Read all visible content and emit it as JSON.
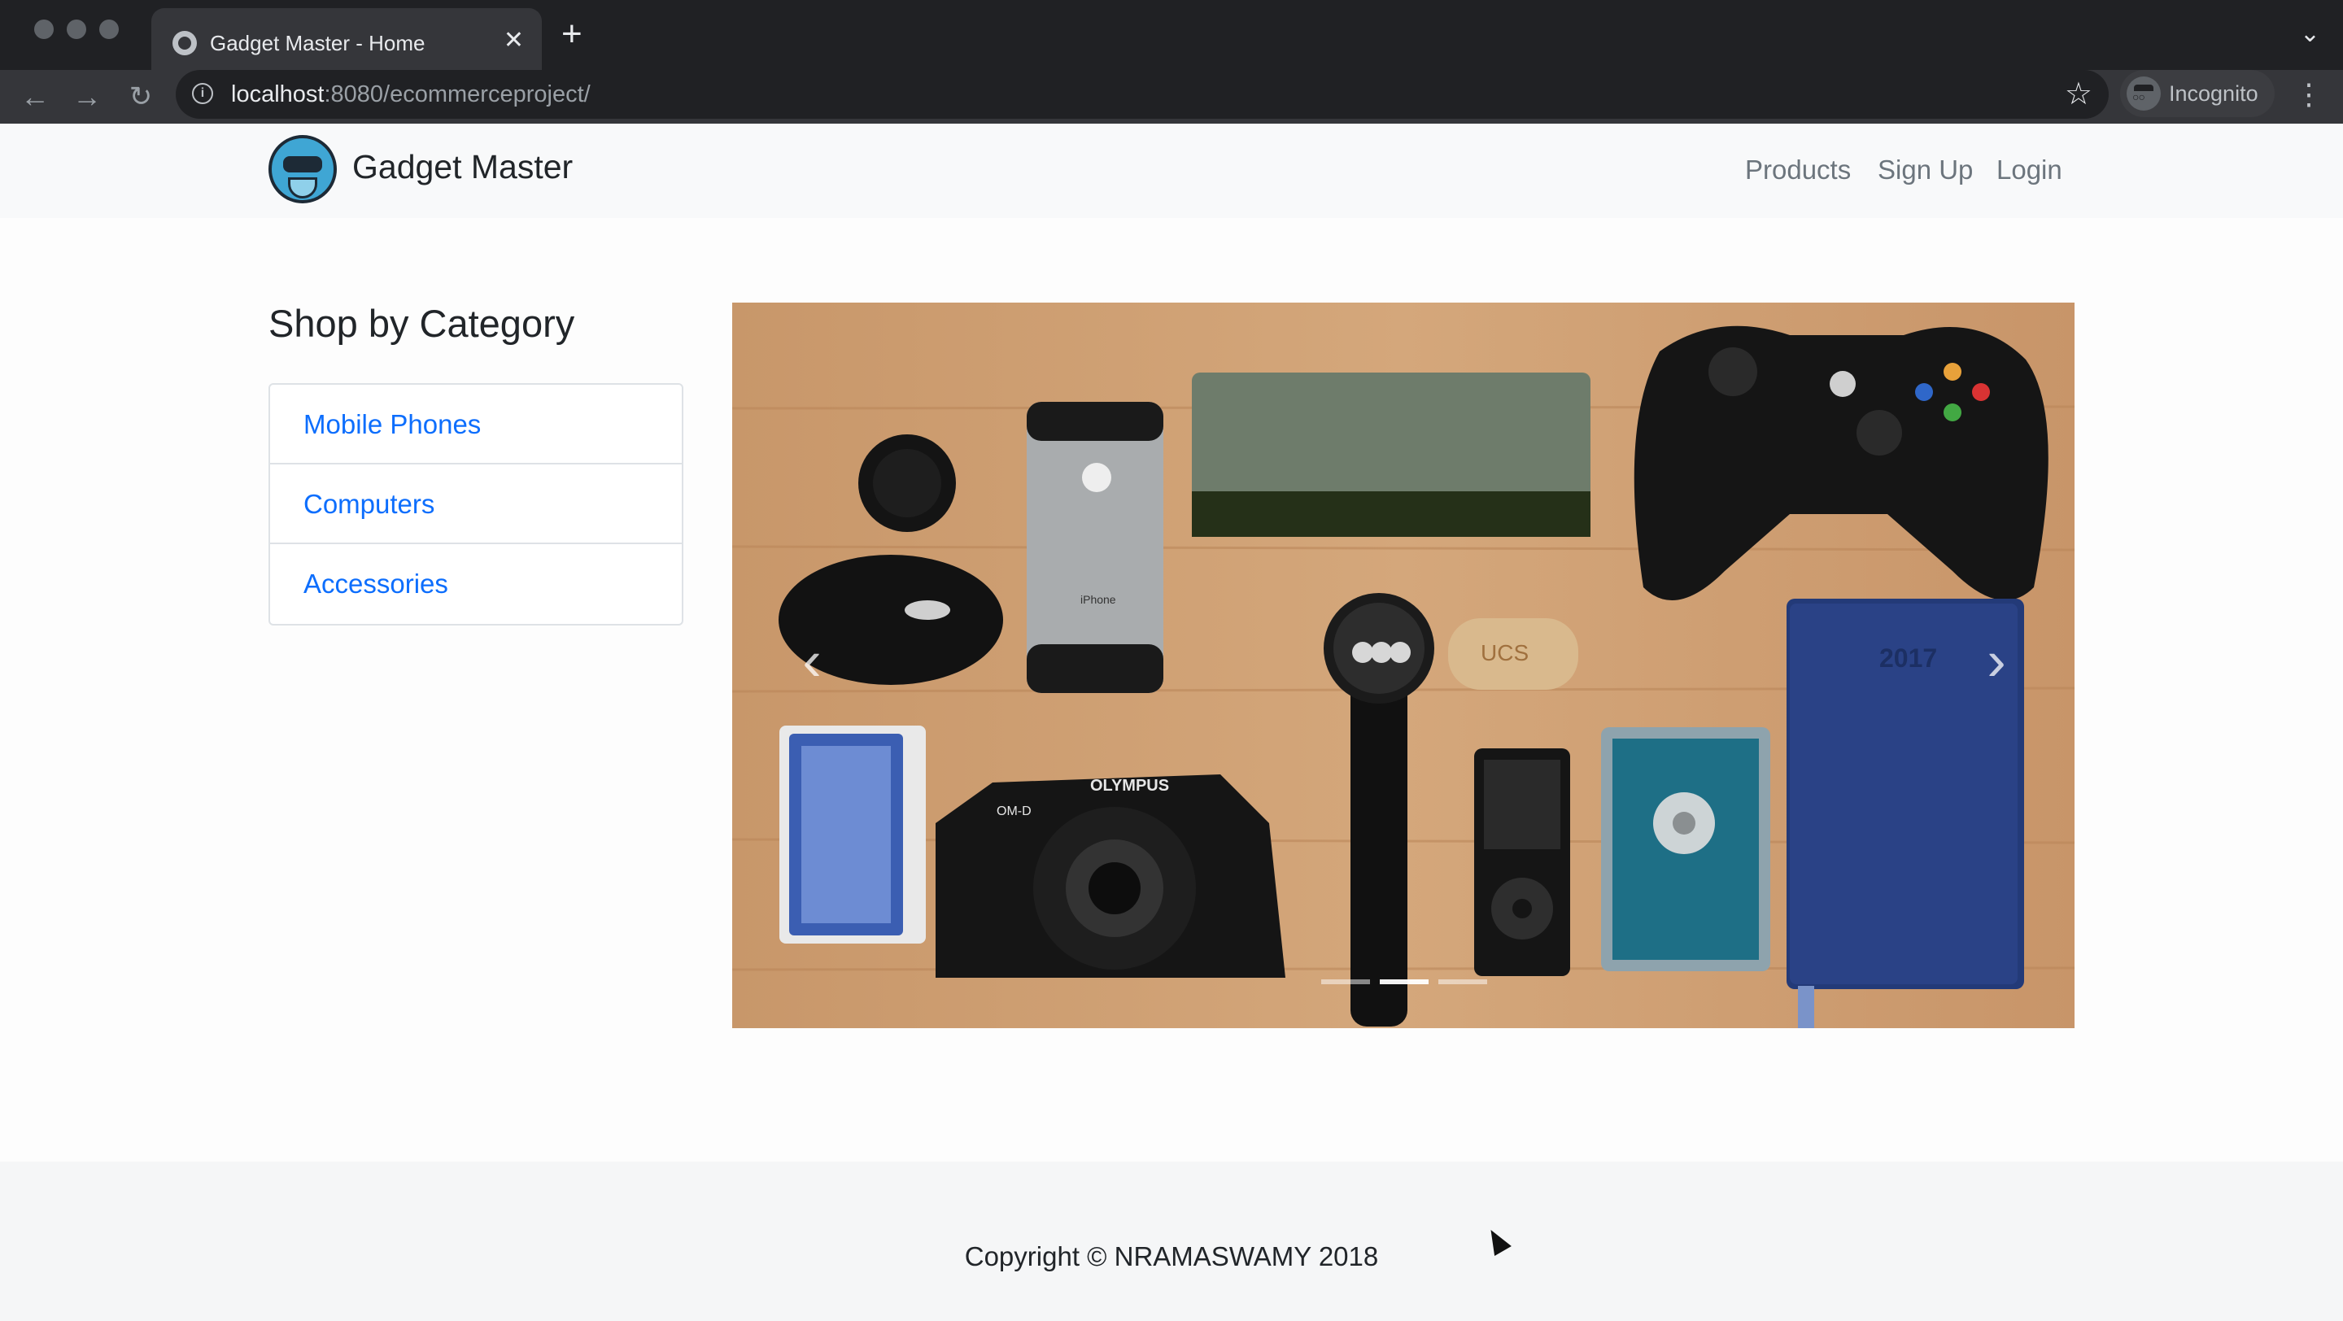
{
  "browser": {
    "tab": {
      "title": "Gadget Master - Home",
      "close_icon": "close-icon"
    },
    "url": {
      "host": "localhost",
      "rest": ":8080/ecommerceproject/"
    },
    "incognito_label": "Incognito"
  },
  "navbar": {
    "brand": "Gadget Master",
    "links": [
      "Products",
      "Sign Up",
      "Login"
    ]
  },
  "sidebar": {
    "heading": "Shop by Category",
    "categories": [
      "Mobile Phones",
      "Computers",
      "Accessories"
    ]
  },
  "carousel": {
    "slide_count": 3,
    "active_slide": 2,
    "image_labels": [
      "iPhone",
      "OLYMPUS",
      "OM-D",
      "UCS",
      "2017"
    ]
  },
  "footer": {
    "copyright": "Copyright © NRAMASWAMY 2018"
  }
}
